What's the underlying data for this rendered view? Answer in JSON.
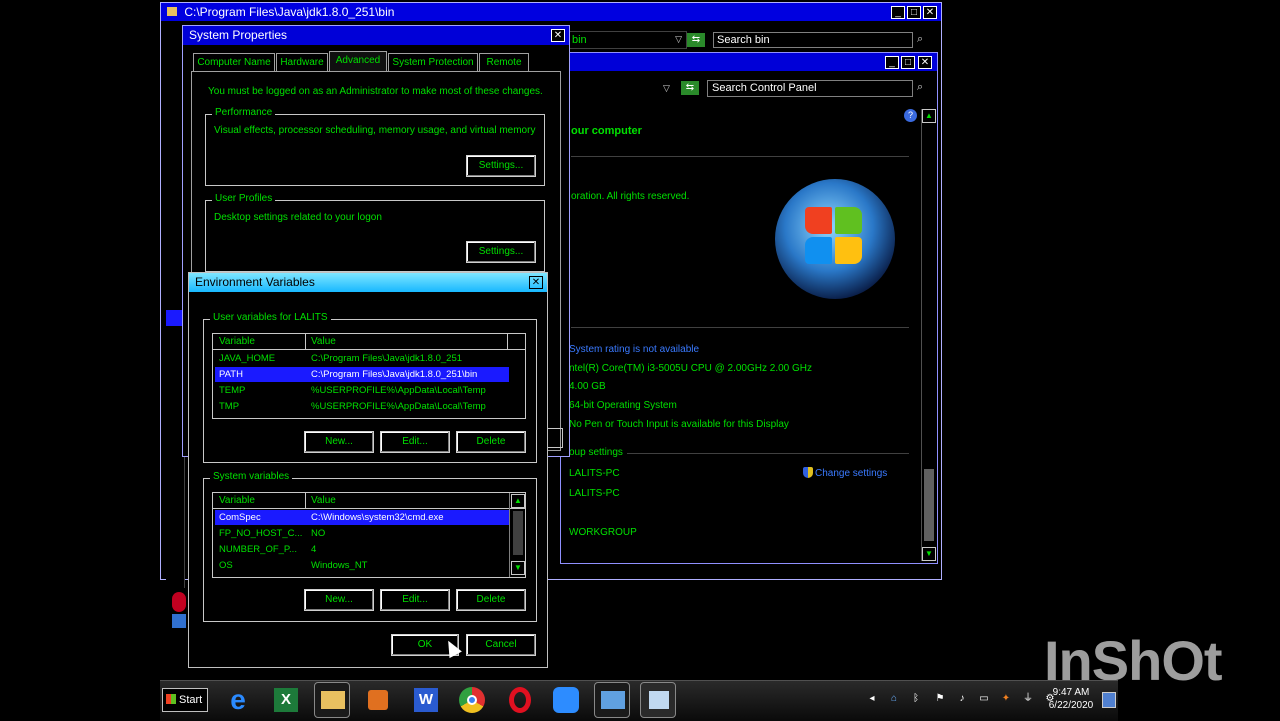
{
  "explorer_window": {
    "title": "C:\\Program Files\\Java\\jdk1.8.0_251\\bin",
    "address_fragment": "bin",
    "search_placeholder": "Search bin"
  },
  "control_panel": {
    "search_placeholder": "Search Control Panel",
    "heading": "our computer",
    "copyright": "oration.  All rights reserved.",
    "rating": "System rating is not available",
    "processor": "ntel(R) Core(TM) i3-5005U CPU @ 2.00GHz   2.00 GHz",
    "memory": "4.00 GB",
    "system_type": "64-bit Operating System",
    "pen_touch": "No Pen or Touch Input is available for this Display",
    "section_group": "oup settings",
    "computer_name": "LALITS-PC",
    "full_name": "LALITS-PC",
    "workgroup": "WORKGROUP",
    "change_settings": "Change settings"
  },
  "system_properties": {
    "title": "System Properties",
    "tabs": [
      "Computer Name",
      "Hardware",
      "Advanced",
      "System Protection",
      "Remote"
    ],
    "active_tab": "Advanced",
    "admin_note": "You must be logged on as an Administrator to make most of these changes.",
    "performance": {
      "label": "Performance",
      "desc": "Visual effects, processor scheduling, memory usage, and virtual memory",
      "button": "Settings..."
    },
    "user_profiles": {
      "label": "User Profiles",
      "desc": "Desktop settings related to your logon",
      "button": "Settings..."
    }
  },
  "env_vars": {
    "title": "Environment Variables",
    "user_group_label": "User variables for LALITS",
    "system_group_label": "System variables",
    "col_variable": "Variable",
    "col_value": "Value",
    "user_rows": [
      {
        "name": "JAVA_HOME",
        "value": "C:\\Program Files\\Java\\jdk1.8.0_251"
      },
      {
        "name": "PATH",
        "value": "C:\\Program Files\\Java\\jdk1.8.0_251\\bin"
      },
      {
        "name": "TEMP",
        "value": "%USERPROFILE%\\AppData\\Local\\Temp"
      },
      {
        "name": "TMP",
        "value": "%USERPROFILE%\\AppData\\Local\\Temp"
      }
    ],
    "system_rows": [
      {
        "name": "ComSpec",
        "value": "C:\\Windows\\system32\\cmd.exe"
      },
      {
        "name": "FP_NO_HOST_C...",
        "value": "NO"
      },
      {
        "name": "NUMBER_OF_P...",
        "value": "4"
      },
      {
        "name": "OS",
        "value": "Windows_NT"
      }
    ],
    "buttons": {
      "new": "New...",
      "edit": "Edit...",
      "delete": "Delete",
      "ok": "OK",
      "cancel": "Cancel"
    }
  },
  "taskbar": {
    "start": "Start",
    "clock_time": "9:47 AM",
    "clock_date": "6/22/2020"
  },
  "watermark": "InShOt",
  "colors": {
    "accent_text": "#00e000",
    "titlebar": "#0000d8",
    "selection": "#1a1aff"
  }
}
